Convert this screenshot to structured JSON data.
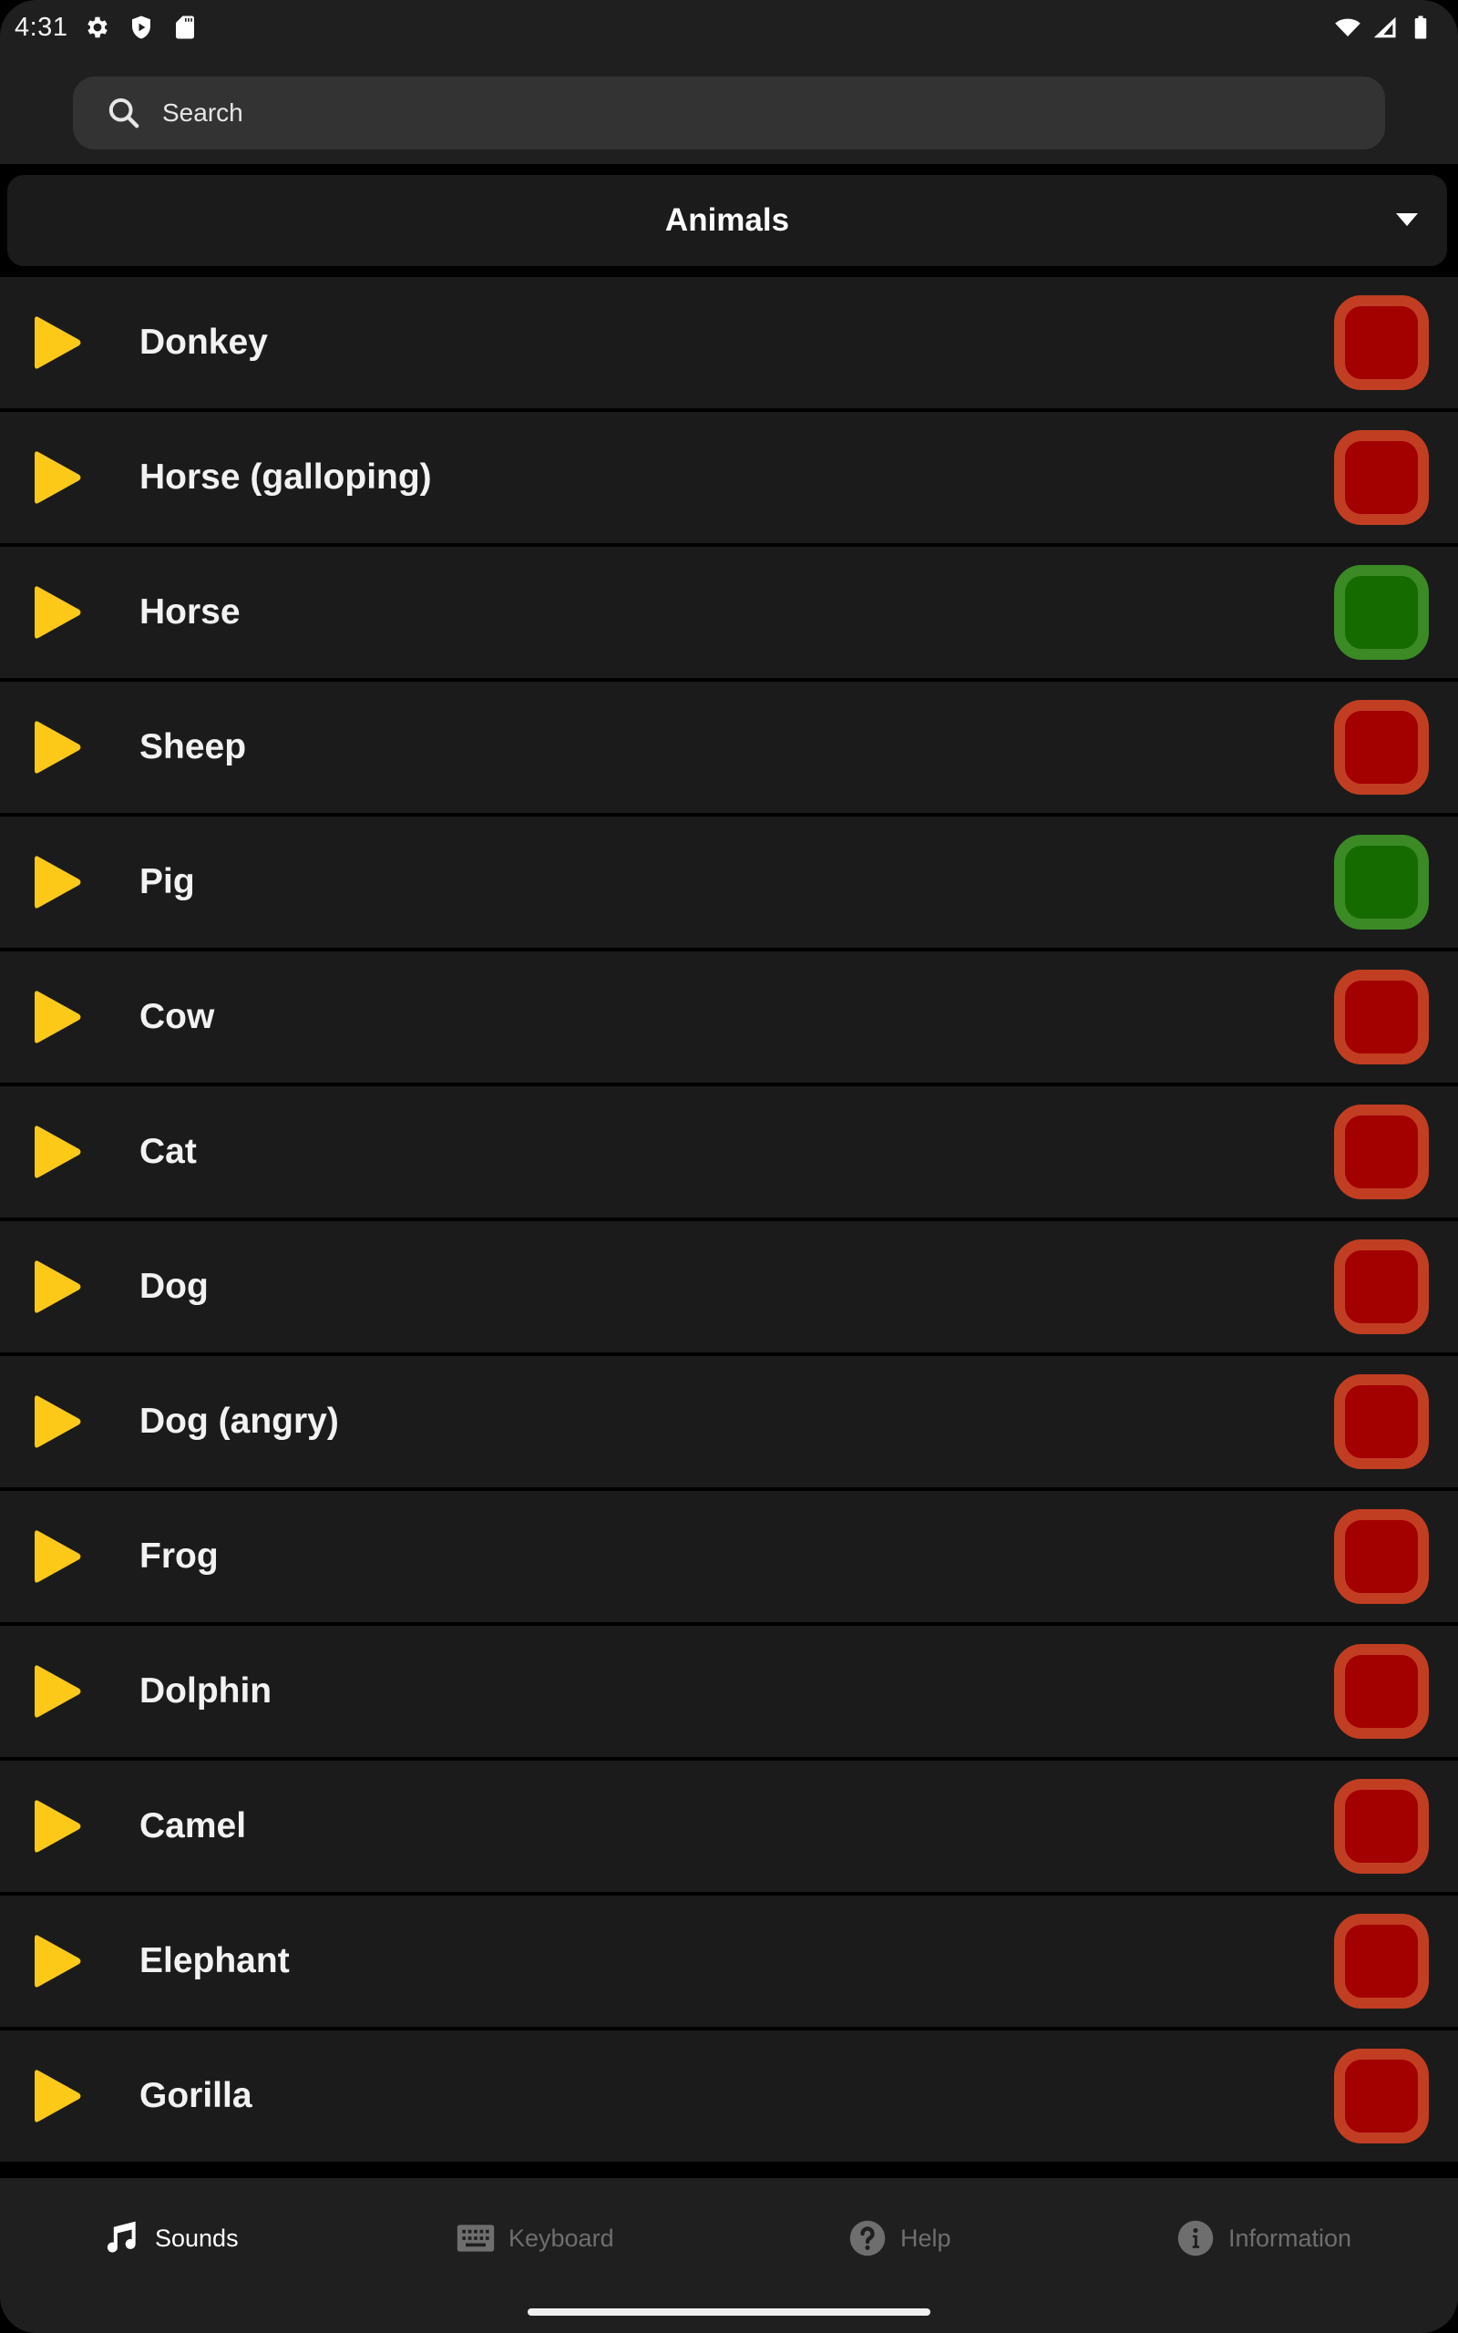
{
  "status_bar": {
    "time": "4:31",
    "left_icons": [
      "gear-icon",
      "shield-play-icon",
      "sd-card-icon"
    ],
    "right_icons": [
      "wifi-icon",
      "cell-signal-icon",
      "battery-icon"
    ]
  },
  "search": {
    "placeholder": "Search",
    "value": ""
  },
  "category": {
    "selected": "Animals"
  },
  "colors": {
    "play": "#fcc919",
    "red_fill": "#a30000",
    "red_border": "#c23e22",
    "green_fill": "#166b00",
    "green_border": "#3b8a26"
  },
  "sounds": [
    {
      "name": "Donkey",
      "status": "red"
    },
    {
      "name": "Horse (galloping)",
      "status": "red"
    },
    {
      "name": "Horse",
      "status": "green"
    },
    {
      "name": "Sheep",
      "status": "red"
    },
    {
      "name": "Pig",
      "status": "green"
    },
    {
      "name": "Cow",
      "status": "red"
    },
    {
      "name": "Cat",
      "status": "red"
    },
    {
      "name": "Dog",
      "status": "red"
    },
    {
      "name": "Dog (angry)",
      "status": "red"
    },
    {
      "name": "Frog",
      "status": "red"
    },
    {
      "name": "Dolphin",
      "status": "red"
    },
    {
      "name": "Camel",
      "status": "red"
    },
    {
      "name": "Elephant",
      "status": "red"
    },
    {
      "name": "Gorilla",
      "status": "red"
    }
  ],
  "bottom_nav": {
    "items": [
      {
        "label": "Sounds",
        "icon": "music-note-icon",
        "active": true
      },
      {
        "label": "Keyboard",
        "icon": "keyboard-icon",
        "active": false
      },
      {
        "label": "Help",
        "icon": "help-circle-icon",
        "active": false
      },
      {
        "label": "Information",
        "icon": "info-circle-icon",
        "active": false
      }
    ],
    "active_color": "#ffffff",
    "inactive_color": "#6e6e6e"
  }
}
